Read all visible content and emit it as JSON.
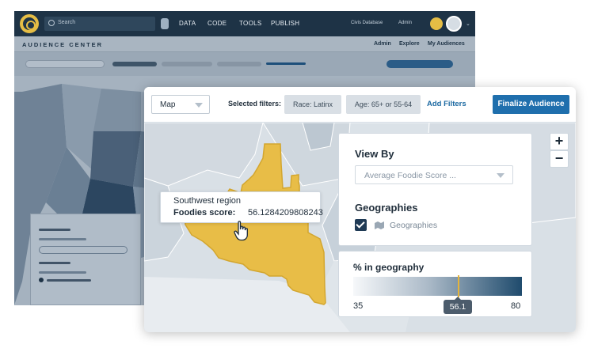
{
  "background_app": {
    "search_placeholder": "Search",
    "nav": [
      "DATA",
      "CODE",
      "TOOLS",
      "PUBLISH"
    ],
    "database_menu": "Civis Database",
    "user_menu": "Admin",
    "section_title": "AUDIENCE CENTER",
    "links": [
      "Admin",
      "Explore",
      "My Audiences"
    ]
  },
  "toolbar": {
    "view_select": "Map",
    "selected_filters_label": "Selected filters:",
    "filters": [
      "Race: Latinx",
      "Age: 65+ or 55-64"
    ],
    "add_filters": "Add Filters",
    "finalize": "Finalize Audience"
  },
  "map": {
    "zoom_in": "+",
    "zoom_out": "−",
    "highlight_color": "#e8bd47",
    "tooltip": {
      "region": "Southwest region",
      "score_label": "Foodies score:",
      "score_value": "56.1284209808243"
    }
  },
  "view_panel": {
    "title": "View By",
    "select_value": "Average Foodie Score ...",
    "geo_title": "Geographies",
    "geo_checkbox_label": "Geographies",
    "geo_checked": true
  },
  "legend": {
    "title": "% in geography",
    "min": "35",
    "max": "80",
    "current": "56.1",
    "gradient_start": "#f6f8fa",
    "gradient_end": "#1f4b6d"
  }
}
